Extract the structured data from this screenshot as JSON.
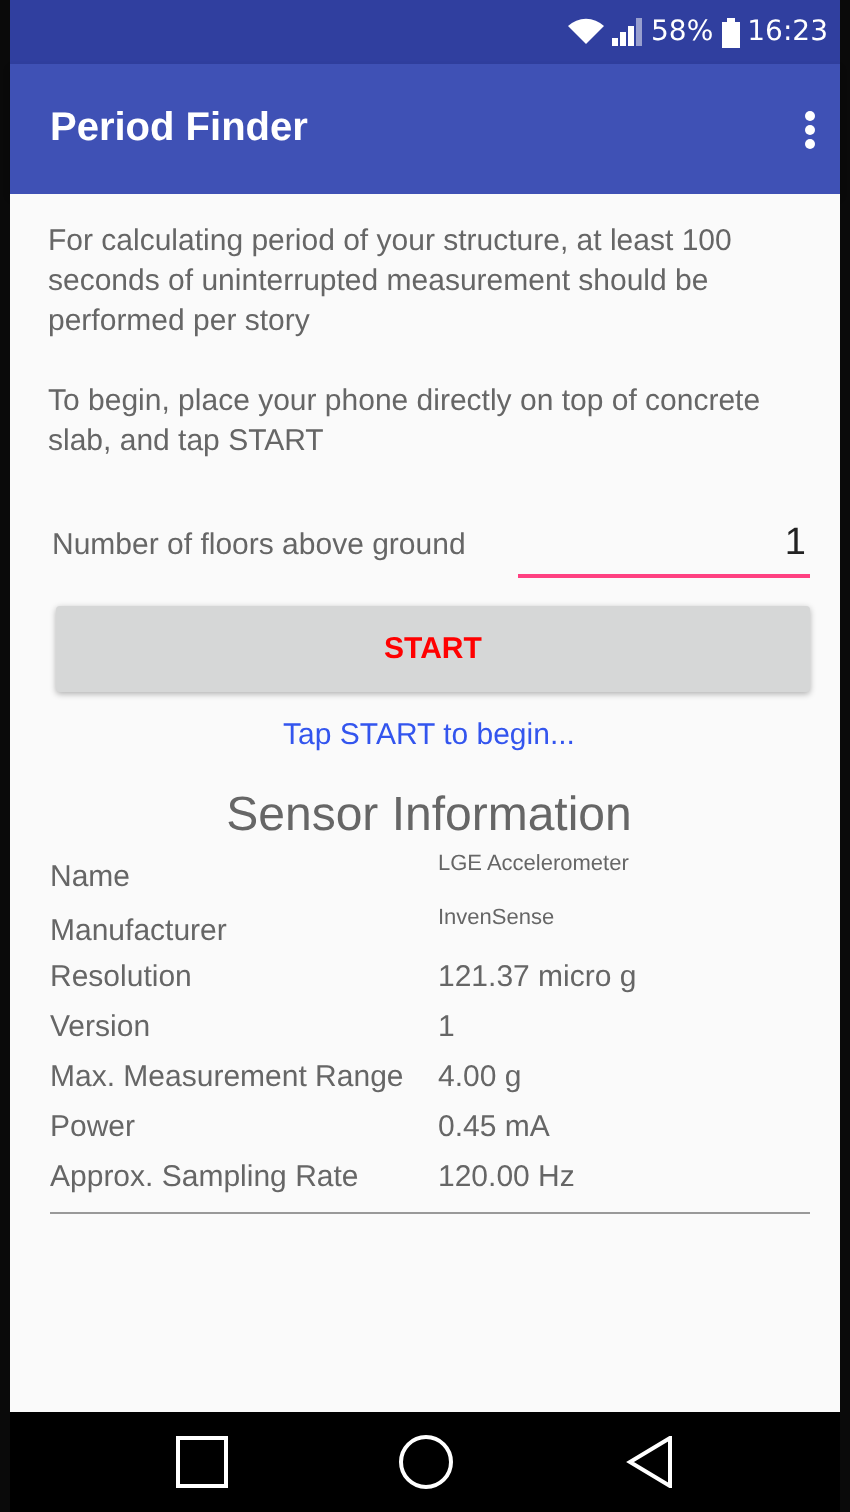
{
  "status_bar": {
    "battery": "58%",
    "time": "16:23"
  },
  "app_bar": {
    "title": "Period Finder"
  },
  "intro": [
    "For calculating period of your structure, at least 100 seconds of uninterrupted measurement should be performed per story",
    "To begin, place your phone directly on top of concrete slab, and tap START"
  ],
  "floors_field": {
    "label": "Number of floors above ground",
    "value": "1"
  },
  "start_button": "START",
  "hint": "Tap START to begin...",
  "sensor": {
    "title": "Sensor Information",
    "rows": [
      {
        "label": "Name",
        "value": "LGE Accelerometer",
        "kind": "small"
      },
      {
        "label": "Manufacturer",
        "value": "InvenSense",
        "kind": "small"
      },
      {
        "label": "Resolution",
        "value": "121.37 micro g",
        "kind": "normal"
      },
      {
        "label": "Version",
        "value": "1",
        "kind": "normal"
      },
      {
        "label": "Max. Measurement Range",
        "value": "4.00 g",
        "kind": "normal"
      },
      {
        "label": "Power",
        "value": "0.45 mA",
        "kind": "normal"
      },
      {
        "label": "Approx. Sampling Rate",
        "value": "120.00 Hz",
        "kind": "normal"
      }
    ]
  }
}
